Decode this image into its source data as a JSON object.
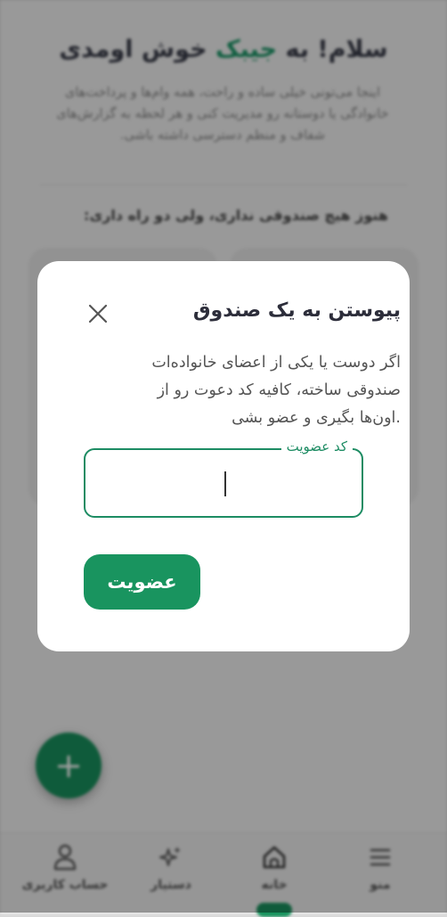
{
  "background": {
    "greeting_prefix": "سلام! به ",
    "brand": "جیبک",
    "greeting_suffix": " خوش اومدی",
    "intro": "اینجا می‌تونی خیلی ساده و راحت، همه وام‌ها و پرداخت‌های خانوادگی یا دوستانه رو مدیریت کنی و هر لحظه به گزارش‌های شفاف و منظم دسترسی داشته باشی.",
    "subtitle": "هنوز هیچ صندوقی نداری، ولی دو راه داری:"
  },
  "fab": {
    "label": "+"
  },
  "bottom_nav": {
    "items": [
      {
        "label": "منو",
        "icon": "menu-icon"
      },
      {
        "label": "خانه",
        "icon": "home-icon"
      },
      {
        "label": "دستیار",
        "icon": "sparkle-icon"
      },
      {
        "label": "حساب کاربری",
        "icon": "user-icon"
      }
    ]
  },
  "dialog": {
    "title": "پیوستن به یک صندوق",
    "body": "اگر دوست یا یکی از اعضای خانواده‌ات صندوقی ساخته، کافیه کد دعوت رو از اون‌ها بگیری و عضو بشی.",
    "field_label": "کد عضویت",
    "field_value": "",
    "join_label": "عضویت",
    "close_icon": "close-icon"
  },
  "colors": {
    "accent": "#19945f",
    "field_border": "#1d8c63",
    "overlay": "rgba(0,0,0,0.38)"
  }
}
